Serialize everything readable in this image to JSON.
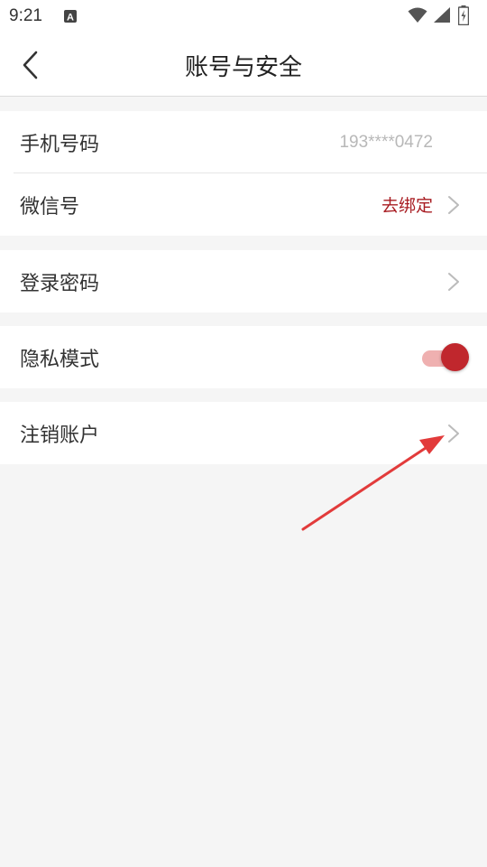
{
  "status_bar": {
    "time": "9:21",
    "icons": [
      "notification-a-icon",
      "wifi-icon",
      "signal-icon",
      "battery-charging-icon"
    ]
  },
  "header": {
    "back_icon": "chevron-left-icon",
    "title": "账号与安全"
  },
  "settings": {
    "phone": {
      "label": "手机号码",
      "value": "193****0472"
    },
    "wechat": {
      "label": "微信号",
      "action": "去绑定"
    },
    "password": {
      "label": "登录密码"
    },
    "privacy": {
      "label": "隐私模式",
      "enabled": true
    },
    "deactivate": {
      "label": "注销账户"
    }
  },
  "colors": {
    "accent": "#c0272d",
    "accent_text": "#a81c22",
    "toggle_track": "#efb0b0",
    "background": "#f5f5f5",
    "annotation_arrow": "#e23b3b"
  }
}
